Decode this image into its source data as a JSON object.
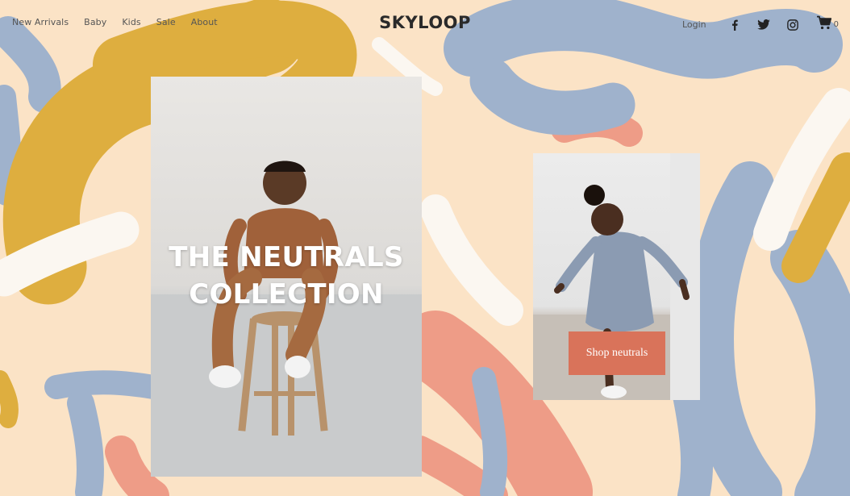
{
  "nav": {
    "items": [
      {
        "label": "New Arrivals"
      },
      {
        "label": "Baby"
      },
      {
        "label": "Kids"
      },
      {
        "label": "Sale"
      },
      {
        "label": "About"
      }
    ]
  },
  "brand": {
    "logo": "SKYLOOP"
  },
  "header_right": {
    "login": "Login",
    "social": [
      "facebook-icon",
      "twitter-icon",
      "instagram-icon"
    ],
    "cart_count": "0"
  },
  "hero": {
    "headline_line1": "THE NEUTRALS",
    "headline_line2": "COLLECTION",
    "cta": "Shop neutrals"
  },
  "colors": {
    "background": "#fbe3c6",
    "mustard": "#deae3f",
    "blue_gray": "#9fb2cc",
    "coral": "#ee9c87",
    "cta": "#d9735a"
  }
}
